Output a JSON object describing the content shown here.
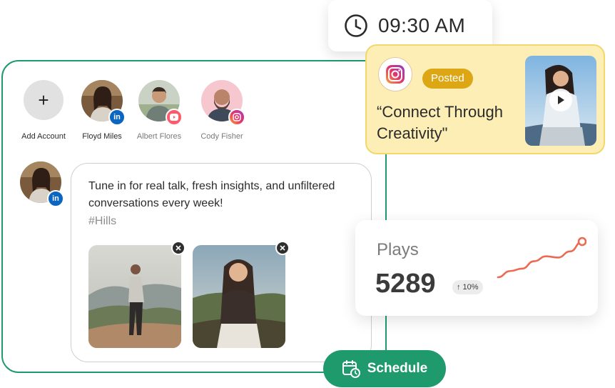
{
  "time": {
    "label": "09:30 AM",
    "icon": "clock-icon"
  },
  "accounts": [
    {
      "name": "Add Account",
      "icon": "plus-icon"
    },
    {
      "name": "Floyd Miles",
      "platform": "linkedin"
    },
    {
      "name": "Albert Flores",
      "platform": "youtube"
    },
    {
      "name": "Cody Fisher",
      "platform": "instagram"
    }
  ],
  "post": {
    "text": "Tune in for real talk, fresh insights, and unfiltered conversations every week!",
    "hashtag": "#Hills",
    "author_platform": "linkedin"
  },
  "instagram_card": {
    "status": "Posted",
    "quote": "“Connect Through Creativity\""
  },
  "stats": {
    "label": "Plays",
    "value": "5289",
    "change": "↑ 10%",
    "sparkline": [
      2,
      3,
      3.4,
      4.6,
      5.4,
      5.2,
      6.2,
      7.8
    ]
  },
  "schedule": {
    "label": "Schedule",
    "icon": "calendar-clock-icon"
  },
  "colors": {
    "brand_green": "#1f9a6c",
    "posted_badge": "#dca614",
    "ig_card_bg": "#fdeeb6",
    "sparkline": "#ec6a52",
    "linkedin": "#0a66c2",
    "youtube": "#ff5a6a"
  }
}
